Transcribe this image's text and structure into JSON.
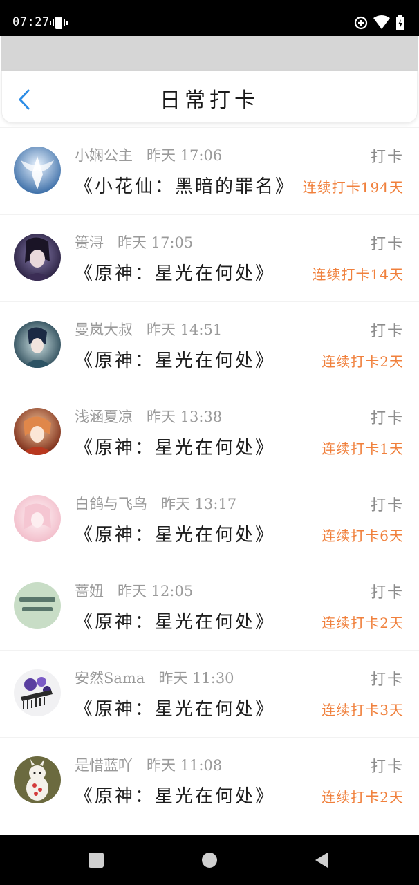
{
  "status_bar": {
    "time": "07:27",
    "icons": [
      "vibrate-icon",
      "data-saver-icon",
      "wifi-icon",
      "battery-icon"
    ]
  },
  "header": {
    "title": "日常打卡",
    "back_icon": "chevron-left-icon"
  },
  "colors": {
    "accent_blue": "#2b8ce6",
    "streak_orange": "#f0803c",
    "meta_gray": "#9a9a9a"
  },
  "items": [
    {
      "user": "小娴公主",
      "time": "昨天 17:06",
      "title": "《小花仙：黑暗的罪名》",
      "action": "打卡",
      "streak": "连续打卡194天"
    },
    {
      "user": "篑浔",
      "time": "昨天 17:05",
      "title": "《原神：星光在何处》",
      "action": "打卡",
      "streak": "连续打卡14天"
    },
    {
      "user": "曼岚大叔",
      "time": "昨天 14:51",
      "title": "《原神：星光在何处》",
      "action": "打卡",
      "streak": "连续打卡2天"
    },
    {
      "user": "浅涵夏凉",
      "time": "昨天 13:38",
      "title": "《原神：星光在何处》",
      "action": "打卡",
      "streak": "连续打卡1天"
    },
    {
      "user": "白鸽与飞鸟",
      "time": "昨天 13:17",
      "title": "《原神：星光在何处》",
      "action": "打卡",
      "streak": "连续打卡6天"
    },
    {
      "user": "蔷妞",
      "time": "昨天 12:05",
      "title": "《原神：星光在何处》",
      "action": "打卡",
      "streak": "连续打卡2天"
    },
    {
      "user": "安然Sama",
      "time": "昨天 11:30",
      "title": "《原神：星光在何处》",
      "action": "打卡",
      "streak": "连续打卡3天"
    },
    {
      "user": "是惜蓝吖",
      "time": "昨天 11:08",
      "title": "《原神：星光在何处》",
      "action": "打卡",
      "streak": "连续打卡2天"
    }
  ],
  "nav_bar": {
    "buttons": [
      "recents-square-icon",
      "home-circle-icon",
      "back-triangle-icon"
    ]
  }
}
